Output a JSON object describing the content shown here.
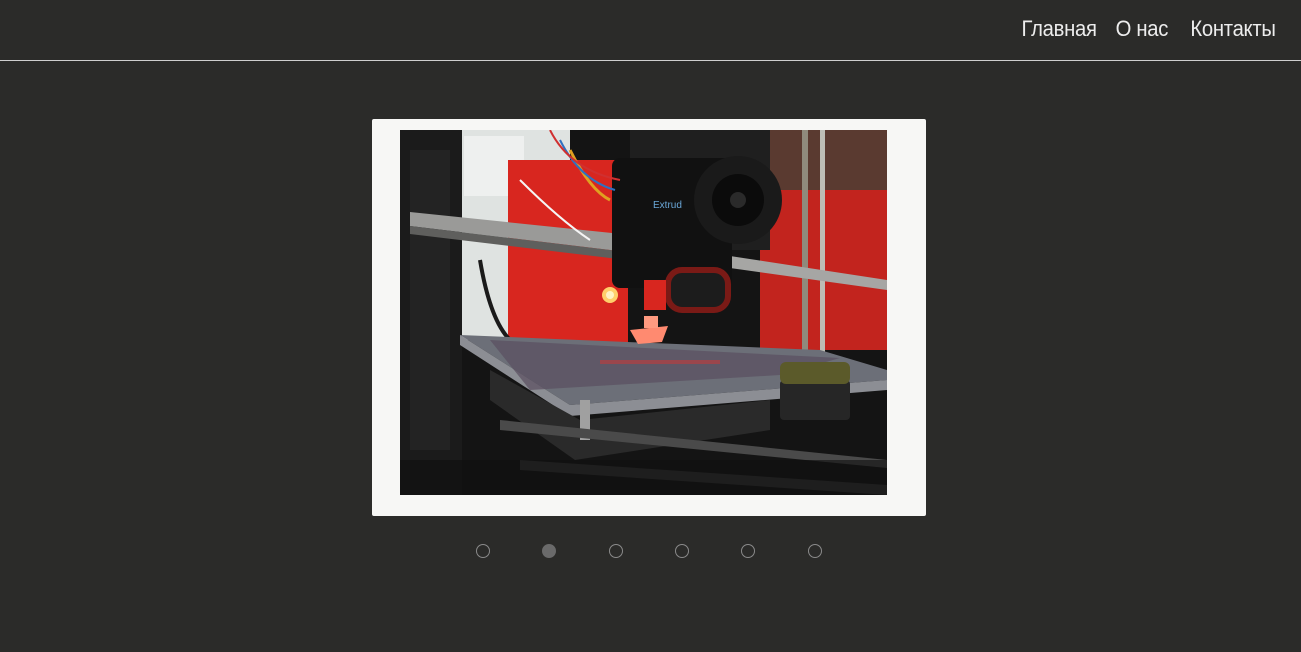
{
  "nav": {
    "items": [
      "Главная",
      "О нас",
      "Контакты"
    ]
  },
  "slider": {
    "image_subject": "3D printer printing a small boat model",
    "extruder_text": "Extrud",
    "total_slides": 6,
    "active_index": 1
  },
  "colors": {
    "background": "#2b2b29",
    "frame": "#f7f7f5",
    "nav_text": "#ededed",
    "accent_red": "#d8261f"
  }
}
